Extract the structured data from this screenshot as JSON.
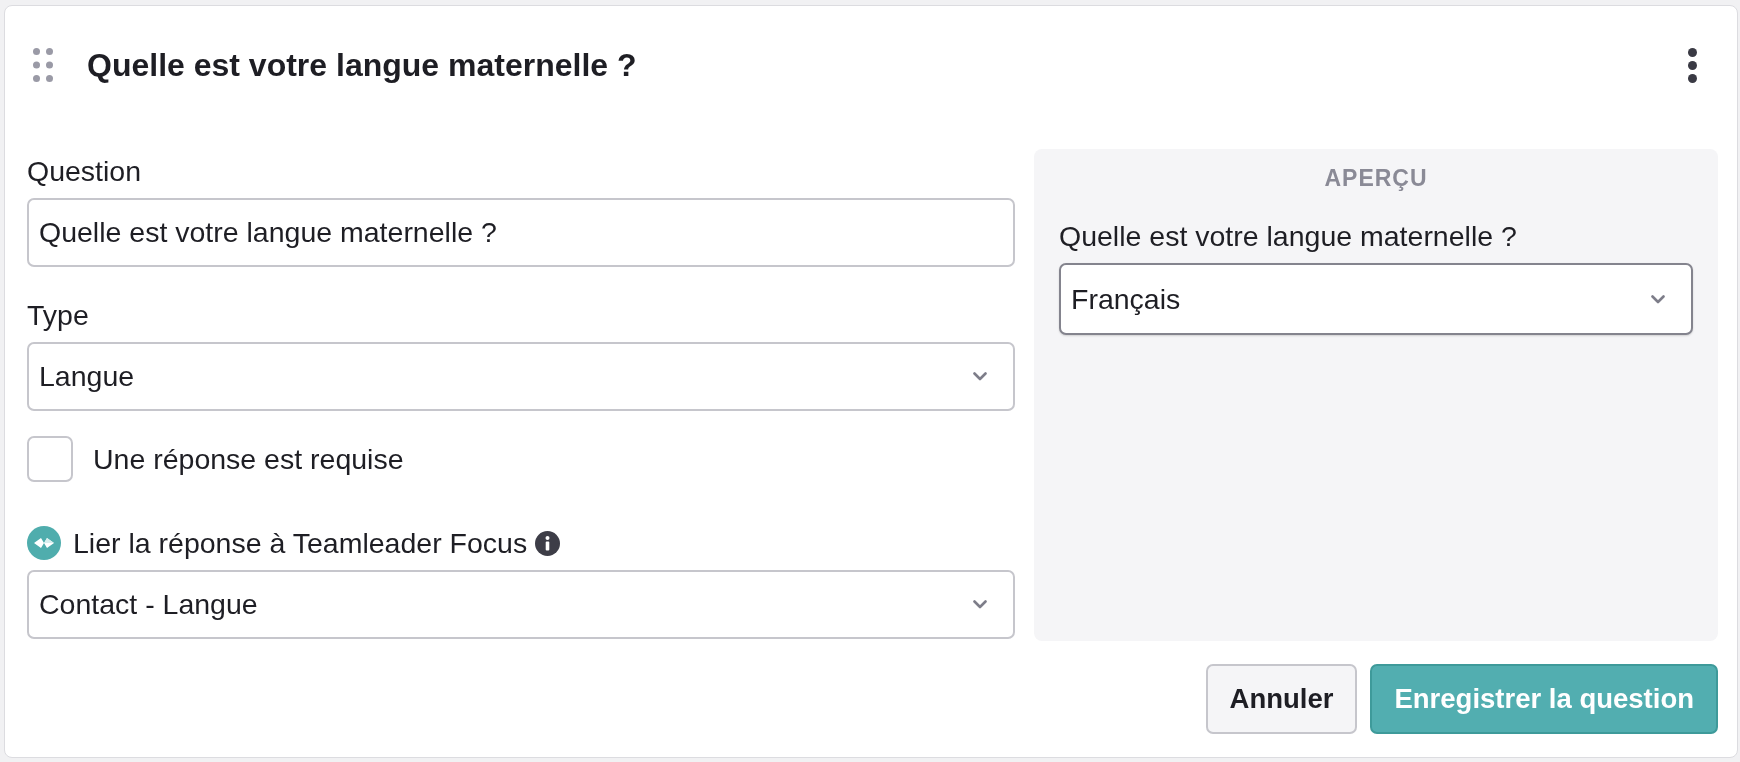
{
  "card": {
    "title": "Quelle est votre langue maternelle ?"
  },
  "fields": [
    {
      "kind": "text",
      "label": "Question",
      "value": "Quelle est votre langue maternelle ?"
    },
    {
      "kind": "select",
      "label": "Type",
      "value": "Langue"
    },
    {
      "kind": "checkbox",
      "label": "Une réponse est requise",
      "checked": false
    },
    {
      "kind": "linked-select",
      "label": "Lier la réponse à Teamleader Focus",
      "value": "Contact - Langue"
    }
  ],
  "preview": {
    "heading": "APERÇU",
    "question": "Quelle est votre langue maternelle ?",
    "value": "Français"
  },
  "buttons": [
    {
      "label": "Annuler",
      "kind": "secondary"
    },
    {
      "label": "Enregistrer la question",
      "kind": "primary"
    }
  ]
}
